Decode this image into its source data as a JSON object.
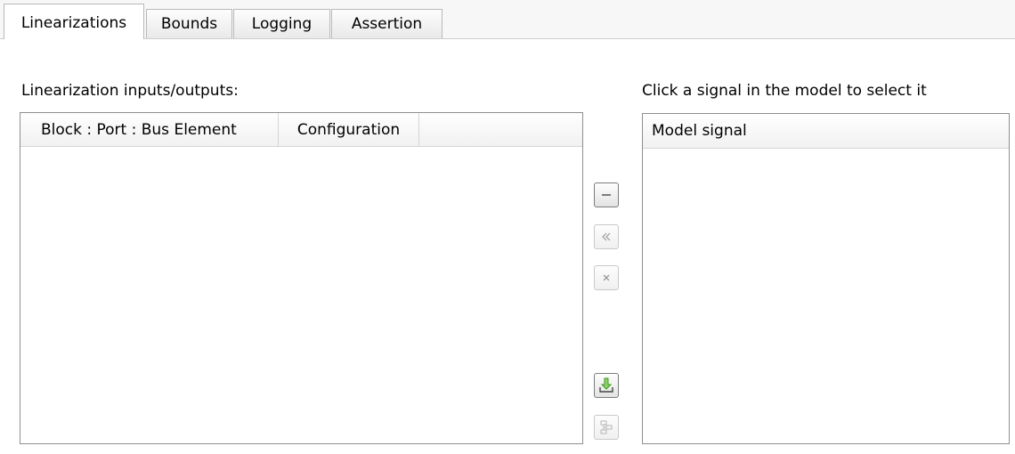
{
  "tabs": [
    {
      "label": "Linearizations",
      "active": true
    },
    {
      "label": "Bounds",
      "active": false
    },
    {
      "label": "Logging",
      "active": false
    },
    {
      "label": "Assertion",
      "active": false
    }
  ],
  "left": {
    "label": "Linearization inputs/outputs:",
    "columns": [
      "Block : Port : Bus Element",
      "Configuration"
    ],
    "rows": []
  },
  "right": {
    "label": "Click a signal in the model to select it",
    "columns": [
      "Model signal"
    ],
    "rows": []
  },
  "buttons": {
    "remove": {
      "icon": "minus-icon",
      "enabled": true
    },
    "move_left": {
      "icon": "double-chevron-left-icon",
      "enabled": false
    },
    "delete": {
      "icon": "x-icon",
      "enabled": false
    },
    "add": {
      "icon": "download-arrow-icon",
      "enabled": true
    },
    "select_in_model": {
      "icon": "model-hierarchy-icon",
      "enabled": false
    }
  },
  "colors": {
    "add_icon_green": "#3c9a1e",
    "panel_border": "#8e8f8f"
  }
}
